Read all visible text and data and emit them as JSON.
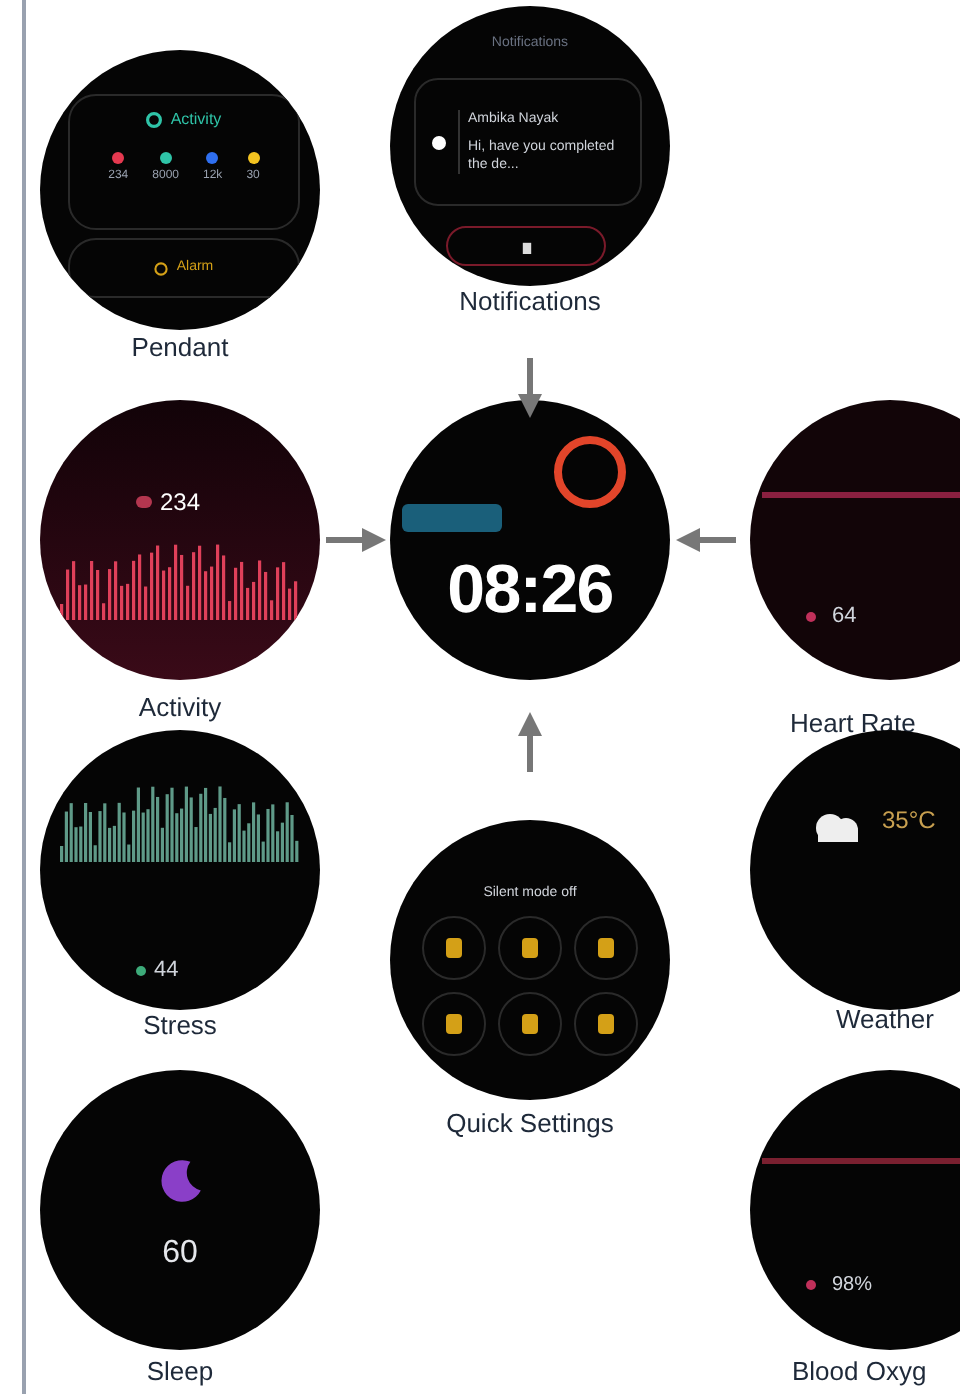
{
  "screens": [
    {
      "kind": "pendant",
      "label": "Pendant",
      "title": "Activity",
      "stats": [
        {
          "value": "234",
          "color": "#e53950"
        },
        {
          "value": "8000",
          "color": "#2fc4a8"
        },
        {
          "value": "12k",
          "color": "#2f6ff0"
        },
        {
          "value": "30",
          "color": "#f3c320"
        }
      ],
      "alarm": "Alarm"
    },
    {
      "kind": "notifications",
      "label": "Notifications",
      "title": "Notifications",
      "sender": "Ambika Nayak",
      "message": "Hi, have you completed the de..."
    },
    {
      "kind": "activity",
      "label": "Activity",
      "value": "234"
    },
    {
      "kind": "watchface",
      "time": "08:26"
    },
    {
      "kind": "heartrate",
      "label": "Heart Rate",
      "value": "64"
    },
    {
      "kind": "stress",
      "label": "Stress",
      "value": "44"
    },
    {
      "kind": "quicksettings",
      "label": "Quick Settings",
      "status": "Silent mode off"
    },
    {
      "kind": "weather",
      "label": "Weather",
      "temperature": "35°C"
    },
    {
      "kind": "sleep",
      "label": "Sleep",
      "value": "60"
    },
    {
      "kind": "bloodoxygen",
      "label": "Blood Oxyg",
      "value": "98%"
    }
  ]
}
